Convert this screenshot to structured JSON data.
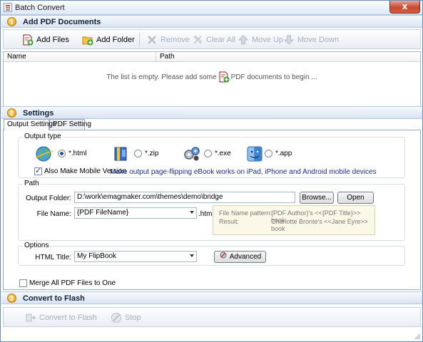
{
  "window": {
    "title": "Batch Convert",
    "close_label": "x"
  },
  "section1": {
    "number": "1",
    "title": "Add PDF Documents",
    "toolbar": {
      "add_files": "Add Files",
      "add_folder": "Add Folder",
      "remove": "Remove",
      "clear_all": "Clear All",
      "move_up": "Move Up",
      "move_down": "Move Down"
    },
    "list": {
      "col_name": "Name",
      "col_path": "Path",
      "empty_prefix": "The list is empty. Please add some",
      "empty_suffix": "PDF documents to begin ..."
    }
  },
  "section2": {
    "number": "2",
    "title": "Settings",
    "tabs": [
      "Output Settings",
      "PDF Setting"
    ],
    "output_type": {
      "legend": "Output type",
      "options": [
        {
          "label": "*.html",
          "checked": true,
          "icon": "globe-icon"
        },
        {
          "label": "*.zip",
          "checked": false,
          "icon": "zip-archive-icon"
        },
        {
          "label": "*.exe",
          "checked": false,
          "icon": "gears-icon"
        },
        {
          "label": "*.app",
          "checked": false,
          "icon": "mac-finder-icon"
        }
      ],
      "mobile_checkbox": "Also Make Mobile Version",
      "mobile_checked": true,
      "mobile_note": "Make output page-flipping eBook works on iPad, iPhone and Android mobile devices"
    },
    "path": {
      "legend": "Path",
      "output_folder_label": "Output Folder:",
      "output_folder_value": "D:\\work\\emagmaker.com\\themes\\demo\\bridge",
      "browse": "Browse...",
      "open": "Open",
      "file_name_label": "File Name:",
      "file_name_value": "{PDF FileName}",
      "file_ext": ".html",
      "pattern_label": "File Name pattern:",
      "pattern_value": "{PDF Author}'s <<{PDF Title}>> book",
      "result_label": "Result:",
      "result_value": "Charlotte Bronte's <<Jane Eyre>> book"
    },
    "options": {
      "legend": "Options",
      "html_title_label": "HTML Title:",
      "html_title_value": "My FlipBook",
      "advanced": "Advanced"
    },
    "merge_checkbox": "Merge All PDF Files to One",
    "merge_checked": false
  },
  "section3": {
    "number": "3",
    "title": "Convert to Flash",
    "convert": "Convert to Flash",
    "stop": "Stop"
  },
  "colors": {
    "section_bg": "#d9e4f1",
    "note_blue": "#1a2f8a",
    "disabled": "#a7afb9"
  }
}
